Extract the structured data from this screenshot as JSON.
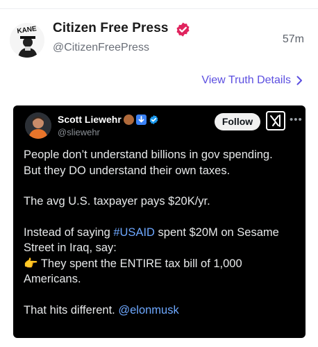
{
  "post": {
    "author_name": "Citizen Free Press",
    "author_handle": "@CitizenFreePress",
    "timestamp": "57m",
    "avatar_text": "KANE",
    "verified_color": "#e0245e",
    "view_details_label": "View Truth Details"
  },
  "embed": {
    "author_name": "Scott Liewehr",
    "author_handle": "@sliewehr",
    "follow_label": "Follow",
    "lines": {
      "l1": "People don’t understand billions in gov spending.",
      "l2": "But they DO understand their own taxes.",
      "l3": "The avg U.S. taxpayer pays $20K/yr.",
      "l4_pre": "Instead of saying ",
      "l4_tag": "#USAID",
      "l4_post": " spent $20M on Sesame",
      "l5": "Street in Iraq, say:",
      "l6_emoji": "👉",
      "l6_text": " They spent the ENTIRE tax bill of 1,000",
      "l7": "Americans.",
      "l8_pre": "That hits different. ",
      "l8_mention": "@elonmusk"
    }
  }
}
